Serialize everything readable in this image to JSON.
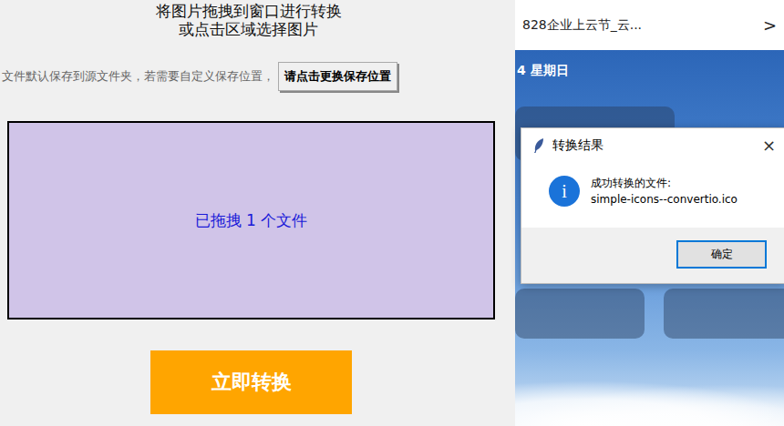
{
  "app": {
    "instruction": [
      "将图片拖拽到窗口进行转换",
      "或点击区域选择图片"
    ],
    "save_hint": "文件默认保存到源文件夹，若需要自定义保存位置，",
    "save_button": "请点击更换保存位置",
    "drop_zone": "已拖拽 1 个文件",
    "convert_button": "立即转换"
  },
  "background_page": {
    "tab_title": "828企业上云节_云...",
    "tab_arrow": ">",
    "date": "4 星期日"
  },
  "dialog": {
    "title": "转换结果",
    "close": "×",
    "icon": "i",
    "message": [
      "成功转换的文件:",
      "simple-icons--convertio.ico"
    ],
    "buttons": [
      "确定"
    ]
  }
}
